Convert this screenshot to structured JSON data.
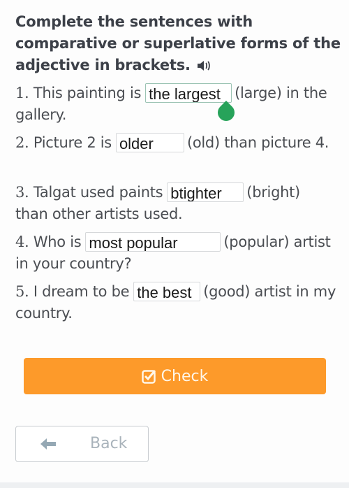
{
  "instruction": {
    "title": "Complete the sentences with comparative or superlative forms of the adjective in brackets.",
    "audio_icon": "speaker-icon"
  },
  "questions": [
    {
      "number": "1.",
      "before": "This painting is",
      "answer": "the largest",
      "after": "(large) in the gallery.",
      "focused": true
    },
    {
      "number": "2.",
      "before": "Picture 2 is",
      "answer": "older",
      "after": "(old) than picture 4."
    },
    {
      "number": "3.",
      "before": "Talgat used paints",
      "answer": "btighter",
      "after": "(bright) than other artists used."
    },
    {
      "number": "4.",
      "before": "Who is",
      "answer": "most popular",
      "after": "(popular) artist in your country?"
    },
    {
      "number": "5.",
      "before": "I dream to be",
      "answer": "the best",
      "after": "(good) artist in my country."
    }
  ],
  "buttons": {
    "check": {
      "label": "Check",
      "icon": "checkbox-icon",
      "color": "#fd9a2a"
    },
    "back": {
      "label": "Back",
      "icon": "arrow-left-icon"
    }
  },
  "colors": {
    "cursor_handle": "#27a35a",
    "focus_border": "#9cc4b4"
  }
}
